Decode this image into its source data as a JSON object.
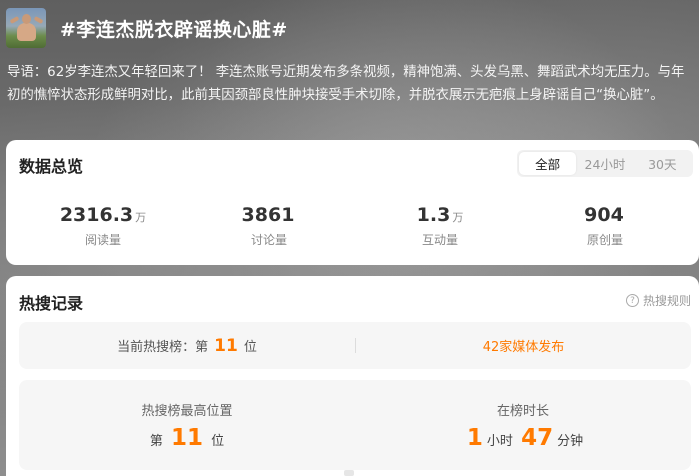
{
  "topic": {
    "title": "#李连杰脱衣辟谣换心脏#",
    "lead": "导语：62岁李连杰又年轻回来了！ 李连杰账号近期发布多条视频，精神饱满、头发乌黑、舞蹈武术均无压力。与年初的憔悴状态形成鲜明对比，此前其因颈部良性肿块接受手术切除，并脱衣展示无疤痕上身辟谣自己“换心脏”。"
  },
  "overview": {
    "title": "数据总览",
    "tabs": [
      {
        "label": "全部",
        "active": true
      },
      {
        "label": "24小时",
        "active": false
      },
      {
        "label": "30天",
        "active": false
      }
    ],
    "stats": [
      {
        "value": "2316.3",
        "unit": "万",
        "label": "阅读量"
      },
      {
        "value": "3861",
        "unit": "",
        "label": "讨论量"
      },
      {
        "value": "1.3",
        "unit": "万",
        "label": "互动量"
      },
      {
        "value": "904",
        "unit": "",
        "label": "原创量"
      }
    ]
  },
  "hot": {
    "title": "热搜记录",
    "rules_label": "热搜规则",
    "current_prefix": "当前热搜榜：第",
    "current_rank": "11",
    "current_suffix": "位",
    "media_link": "42家媒体发布",
    "peak_title": "热搜榜最高位置",
    "peak_prefix": "第",
    "peak_rank": "11",
    "peak_suffix": "位",
    "duration_title": "在榜时长",
    "duration_hours": "1",
    "duration_hours_unit": "小时",
    "duration_minutes": "47",
    "duration_minutes_unit": "分钟"
  },
  "colors": {
    "accent": "#ff7a00",
    "card": "#ffffff"
  }
}
